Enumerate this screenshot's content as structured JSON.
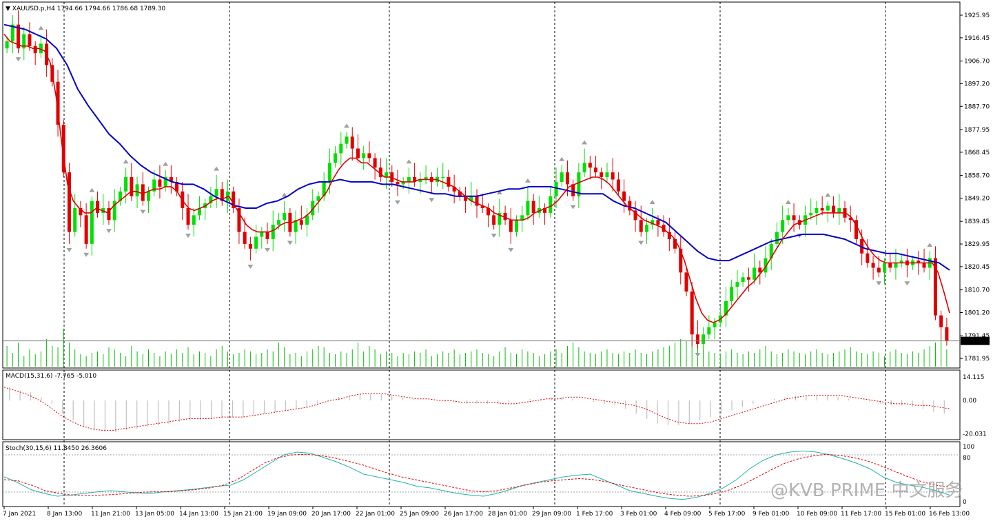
{
  "colors": {
    "bull": "#00e000",
    "bear": "#e00000",
    "ma_fast": "#dd0000",
    "ma_slow": "#0000c8",
    "volume": "#00c000",
    "macd_hist": "#c0c0c0",
    "macd_signal": "#dd0000",
    "stoch_main": "#20b2aa",
    "stoch_signal": "#dd0000",
    "fractal": "#a0a0a0",
    "grid": "#000000",
    "current_price_bg": "#000000",
    "current_price_fg": "#ffffff"
  },
  "header": {
    "symbol_line": "XAUUSD.p,H4  1794.66 1794.66 1786.68 1789.30"
  },
  "current_price": "1789.30",
  "chart_data": [
    {
      "type": "candlestick",
      "title": "XAUUSD.p,H4",
      "ohlc_label": "1794.66 1794.66 1786.68 1789.30",
      "ylim": [
        1778.5,
        1930
      ],
      "y_ticks": [
        "1925.95",
        "1916.45",
        "1906.70",
        "1897.20",
        "1887.70",
        "1877.95",
        "1868.45",
        "1858.70",
        "1849.20",
        "1839.45",
        "1829.95",
        "1820.45",
        "1810.70",
        "1801.20",
        "1791.45",
        "1781.95"
      ],
      "x_labels": [
        "7 Jan 2021",
        "8 Jan 13:00",
        "11 Jan 21:00",
        "13 Jan 05:00",
        "14 Jan 13:00",
        "15 Jan 21:00",
        "19 Jan 09:00",
        "20 Jan 17:00",
        "22 Jan 01:00",
        "25 Jan 09:00",
        "26 Jan 17:00",
        "28 Jan 01:00",
        "29 Jan 09:00",
        "1 Feb 17:00",
        "3 Feb 01:00",
        "4 Feb 09:00",
        "5 Feb 17:00",
        "9 Feb 01:00",
        "10 Feb 09:00",
        "11 Feb 17:00",
        "15 Feb 01:00",
        "16 Feb 13:00"
      ],
      "close_series": [
        1915,
        1922,
        1912,
        1918,
        1913,
        1910,
        1914,
        1905,
        1898,
        1880,
        1860,
        1835,
        1845,
        1842,
        1830,
        1848,
        1843,
        1845,
        1840,
        1848,
        1852,
        1858,
        1850,
        1855,
        1848,
        1852,
        1857,
        1854,
        1858,
        1856,
        1852,
        1845,
        1838,
        1842,
        1845,
        1847,
        1850,
        1853,
        1848,
        1852,
        1845,
        1835,
        1830,
        1828,
        1833,
        1835,
        1832,
        1838,
        1840,
        1843,
        1835,
        1840,
        1838,
        1842,
        1848,
        1850,
        1856,
        1864,
        1868,
        1872,
        1875,
        1870,
        1866,
        1868,
        1866,
        1862,
        1858,
        1860,
        1856,
        1855,
        1856,
        1858,
        1856,
        1857,
        1858,
        1856,
        1858,
        1858,
        1854,
        1852,
        1850,
        1848,
        1850,
        1846,
        1845,
        1842,
        1838,
        1843,
        1840,
        1835,
        1840,
        1842,
        1848,
        1843,
        1845,
        1843,
        1850,
        1856,
        1860,
        1855,
        1850,
        1860,
        1864,
        1862,
        1860,
        1858,
        1860,
        1857,
        1852,
        1848,
        1844,
        1840,
        1835,
        1838,
        1840,
        1838,
        1835,
        1832,
        1828,
        1818,
        1810,
        1792,
        1788,
        1792,
        1795,
        1797,
        1800,
        1806,
        1812,
        1814,
        1816,
        1815,
        1820,
        1818,
        1824,
        1830,
        1835,
        1840,
        1842,
        1840,
        1838,
        1842,
        1843,
        1845,
        1844,
        1846,
        1843,
        1845,
        1841,
        1840,
        1832,
        1826,
        1822,
        1820,
        1818,
        1822,
        1820,
        1822,
        1823,
        1821,
        1823,
        1822,
        1820,
        1824,
        1800,
        1795,
        1789.3
      ],
      "ma_fast": [
        1918,
        1915,
        1914,
        1913,
        1913,
        1912,
        1912,
        1911,
        1906,
        1892,
        1872,
        1855,
        1848,
        1845,
        1843,
        1843,
        1845,
        1844,
        1843,
        1846,
        1848,
        1850,
        1852,
        1852,
        1851,
        1852,
        1853,
        1853,
        1854,
        1854,
        1852,
        1848,
        1845,
        1844,
        1845,
        1846,
        1848,
        1849,
        1849,
        1850,
        1846,
        1842,
        1838,
        1836,
        1835,
        1835,
        1835,
        1836,
        1838,
        1839,
        1839,
        1840,
        1841,
        1843,
        1846,
        1849,
        1852,
        1857,
        1861,
        1864,
        1866,
        1866,
        1864,
        1864,
        1862,
        1860,
        1858,
        1858,
        1857,
        1856,
        1856,
        1856,
        1857,
        1857,
        1857,
        1857,
        1856,
        1855,
        1854,
        1852,
        1850,
        1848,
        1847,
        1846,
        1845,
        1843,
        1842,
        1841,
        1840,
        1840,
        1840,
        1841,
        1843,
        1844,
        1845,
        1846,
        1848,
        1851,
        1854,
        1855,
        1856,
        1857,
        1858,
        1858,
        1857,
        1855,
        1852,
        1849,
        1846,
        1844,
        1842,
        1840,
        1839,
        1838,
        1837,
        1835,
        1833,
        1829,
        1823,
        1815,
        1807,
        1801,
        1798,
        1797,
        1798,
        1800,
        1803,
        1806,
        1809,
        1812,
        1814,
        1817,
        1820,
        1824,
        1828,
        1832,
        1835,
        1838,
        1839,
        1840,
        1841,
        1842,
        1843,
        1843,
        1843,
        1843,
        1843,
        1841,
        1837,
        1832,
        1828,
        1825,
        1823,
        1822,
        1822,
        1822,
        1822,
        1822,
        1822,
        1822,
        1822,
        1822,
        1818,
        1810,
        1801
      ],
      "ma_slow": [
        1922,
        1921,
        1920,
        1918,
        1916,
        1912,
        1905,
        1895,
        1888,
        1882,
        1876,
        1872,
        1867,
        1863,
        1860,
        1858,
        1856,
        1855,
        1855,
        1853,
        1850,
        1848,
        1846,
        1845,
        1845,
        1847,
        1848,
        1850,
        1853,
        1855,
        1856,
        1856,
        1857,
        1856,
        1856,
        1856,
        1855,
        1855,
        1854,
        1853,
        1852,
        1851,
        1851,
        1850,
        1850,
        1850,
        1851,
        1852,
        1853,
        1853,
        1854,
        1854,
        1854,
        1853,
        1852,
        1851,
        1851,
        1851,
        1848,
        1846,
        1845,
        1843,
        1841,
        1839,
        1835,
        1831,
        1827,
        1824,
        1823,
        1823,
        1825,
        1827,
        1829,
        1831,
        1832,
        1833,
        1834,
        1834,
        1834,
        1833,
        1832,
        1830,
        1828,
        1827,
        1826,
        1826,
        1825,
        1824,
        1823,
        1822,
        1819
      ],
      "volume_series": [
        30,
        20,
        35,
        15,
        25,
        18,
        22,
        40,
        30,
        28,
        55,
        35,
        25,
        18,
        15,
        20,
        22,
        18,
        28,
        25,
        20,
        15,
        30,
        22,
        18,
        25,
        20,
        15,
        22,
        18,
        25,
        20,
        28,
        18,
        22,
        20,
        15,
        25,
        30,
        22,
        18,
        20,
        25,
        22,
        18,
        20,
        25,
        22,
        35,
        28,
        18,
        20,
        15,
        22,
        25,
        30,
        28,
        20,
        18,
        22,
        20,
        25,
        35,
        22,
        30,
        25,
        18,
        22,
        20,
        15,
        20,
        18,
        22,
        20,
        25,
        15,
        18,
        22,
        20,
        25,
        18,
        20,
        22,
        25,
        20,
        18,
        15,
        22,
        28,
        20,
        18,
        25,
        22,
        20,
        15,
        18,
        22,
        25,
        20,
        30,
        35,
        28,
        22,
        20,
        18,
        22,
        25,
        20,
        18,
        22,
        20,
        25,
        20,
        18,
        22,
        25,
        28,
        30,
        35,
        40,
        38,
        45,
        30,
        25,
        22,
        20,
        18,
        22,
        25,
        20,
        18,
        22,
        20,
        25,
        30,
        22,
        18,
        20,
        25,
        22,
        20,
        18,
        22,
        25,
        20,
        18,
        20,
        22,
        25,
        28,
        22,
        20,
        18,
        22,
        20,
        15,
        22,
        25,
        20,
        18,
        22,
        20,
        25,
        30,
        35,
        40,
        25
      ]
    },
    {
      "type": "line",
      "title": "MACD(15,31,6) -7.765 -5.010",
      "y_ticks": [
        "14.115",
        "0.00",
        "-20.031"
      ],
      "ylim": [
        -22,
        15
      ],
      "signal": [
        8,
        6,
        4,
        1,
        -3,
        -8,
        -12,
        -15,
        -17,
        -18,
        -18,
        -17,
        -16,
        -15,
        -14,
        -13,
        -12,
        -11,
        -11,
        -11,
        -10,
        -10,
        -10,
        -9,
        -8,
        -7,
        -6,
        -5,
        -4,
        -2,
        0,
        1,
        3,
        4,
        4,
        4,
        3,
        2,
        1,
        1,
        0,
        0,
        -1,
        -1,
        -1,
        -1,
        -2,
        -2,
        -1,
        0,
        1,
        1,
        2,
        2,
        1,
        0,
        -1,
        -2,
        -3,
        -5,
        -8,
        -11,
        -13,
        -14,
        -14,
        -13,
        -11,
        -9,
        -7,
        -5,
        -3,
        -1,
        1,
        2,
        3,
        3,
        3,
        3,
        2,
        1,
        0,
        -1,
        -2,
        -2,
        -3,
        -3,
        -4,
        -5
      ],
      "hist": [
        8,
        6,
        5,
        2,
        -2,
        -8,
        -12,
        -16,
        -18,
        -19,
        -19,
        -18,
        -17,
        -16,
        -15,
        -14,
        -13,
        -12,
        -12,
        -11,
        -11,
        -10,
        -10,
        -9,
        -8,
        -7,
        -6,
        -5,
        -4,
        -2,
        0,
        2,
        3,
        4,
        4,
        4,
        3,
        2,
        1,
        0,
        0,
        -1,
        -1,
        -2,
        -2,
        -2,
        -2,
        -1,
        0,
        1,
        1,
        2,
        2,
        1,
        0,
        -1,
        -2,
        -3,
        -5,
        -8,
        -11,
        -14,
        -15,
        -15,
        -14,
        -12,
        -10,
        -8,
        -6,
        -4,
        -2,
        0,
        1,
        2,
        3,
        3,
        3,
        3,
        2,
        1,
        0,
        -1,
        -2,
        -3,
        -3,
        -4,
        -5,
        -7,
        -8
      ]
    },
    {
      "type": "line",
      "title": "Stoch(30,15,6) 11.8450 26.3606",
      "y_ticks": [
        "100",
        "80",
        "0"
      ],
      "ylim": [
        0,
        100
      ],
      "main": [
        45,
        35,
        22,
        15,
        10,
        12,
        15,
        18,
        20,
        18,
        16,
        15,
        18,
        20,
        22,
        25,
        28,
        30,
        40,
        55,
        70,
        85,
        90,
        88,
        80,
        72,
        62,
        50,
        45,
        40,
        35,
        28,
        25,
        20,
        15,
        12,
        10,
        15,
        22,
        30,
        35,
        40,
        45,
        48,
        50,
        40,
        30,
        20,
        15,
        10,
        6,
        4,
        8,
        15,
        25,
        40,
        60,
        75,
        85,
        90,
        92,
        90,
        85,
        78,
        70,
        60,
        45,
        35,
        30,
        26,
        20,
        12
      ],
      "signal": [
        40,
        38,
        30,
        20,
        15,
        12,
        11,
        12,
        13,
        15,
        17,
        18,
        18,
        20,
        22,
        25,
        30,
        40,
        55,
        70,
        80,
        85,
        86,
        84,
        80,
        74,
        68,
        60,
        52,
        45,
        40,
        35,
        30,
        25,
        20,
        18,
        20,
        25,
        30,
        35,
        38,
        40,
        42,
        40,
        36,
        30,
        25,
        20,
        15,
        12,
        10,
        11,
        15,
        22,
        32,
        45,
        58,
        70,
        78,
        83,
        86,
        84,
        80,
        74,
        65,
        55,
        45,
        36,
        30,
        26
      ]
    }
  ],
  "watermark": "@KVB PRIME 中文服务"
}
